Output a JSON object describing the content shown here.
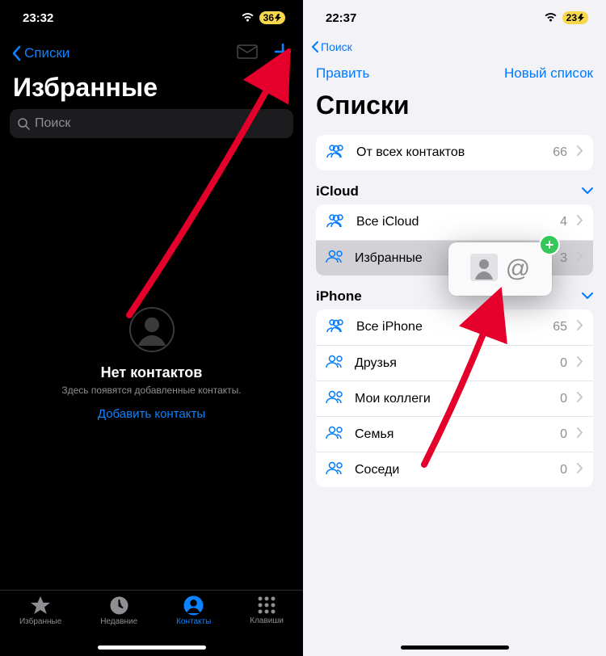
{
  "left": {
    "status": {
      "time": "23:32",
      "battery": "36"
    },
    "nav": {
      "back": "Списки"
    },
    "title": "Избранные",
    "search_placeholder": "Поиск",
    "empty": {
      "title": "Нет контактов",
      "subtitle": "Здесь появятся добавленные контакты.",
      "action": "Добавить контакты"
    },
    "tabs": [
      {
        "label": "Избранные"
      },
      {
        "label": "Недавние"
      },
      {
        "label": "Контакты"
      },
      {
        "label": "Клавиши"
      }
    ]
  },
  "right": {
    "status": {
      "time": "22:37",
      "battery": "23"
    },
    "back_search": "Поиск",
    "toolbar": {
      "edit": "Править",
      "new_list": "Новый список"
    },
    "title": "Списки",
    "all": {
      "label": "От всех контактов",
      "count": "66"
    },
    "groups": [
      {
        "name": "iCloud",
        "items": [
          {
            "label": "Все iCloud",
            "count": "4",
            "three": true
          },
          {
            "label": "Избранные",
            "count": "3",
            "selected": true
          }
        ]
      },
      {
        "name": "iPhone",
        "items": [
          {
            "label": "Все iPhone",
            "count": "65",
            "three": true
          },
          {
            "label": "Друзья",
            "count": "0"
          },
          {
            "label": "Мои коллеги",
            "count": "0"
          },
          {
            "label": "Семья",
            "count": "0"
          },
          {
            "label": "Соседи",
            "count": "0"
          }
        ]
      }
    ],
    "drag": {
      "at": "@"
    }
  }
}
